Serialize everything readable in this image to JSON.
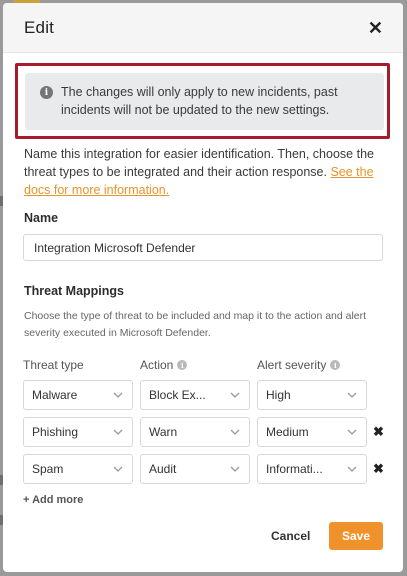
{
  "modal": {
    "title": "Edit",
    "notice": "The changes will only apply to new incidents, past incidents will not be updated to the new settings.",
    "intro_text": "Name this integration for easier identification. Then, choose the threat types to be integrated and their action response. ",
    "intro_link": "See the docs for more information.",
    "name_label": "Name",
    "name_value": "Integration Microsoft Defender",
    "mappings_label": "Threat Mappings",
    "mappings_desc": "Choose the type of threat to be included and map it to the action and alert severity executed in Microsoft Defender.",
    "columns": {
      "threat": "Threat type",
      "action": "Action",
      "severity": "Alert severity"
    },
    "rows": [
      {
        "threat": "Malware",
        "action": "Block Ex...",
        "severity": "High"
      },
      {
        "threat": "Phishing",
        "action": "Warn",
        "severity": "Medium"
      },
      {
        "threat": "Spam",
        "action": "Audit",
        "severity": "Informati..."
      }
    ],
    "add_more": "+ Add more",
    "cancel": "Cancel",
    "save": "Save"
  },
  "colors": {
    "accent": "#f0922b",
    "highlight_border": "#a61c2a",
    "link": "#e6952a"
  }
}
